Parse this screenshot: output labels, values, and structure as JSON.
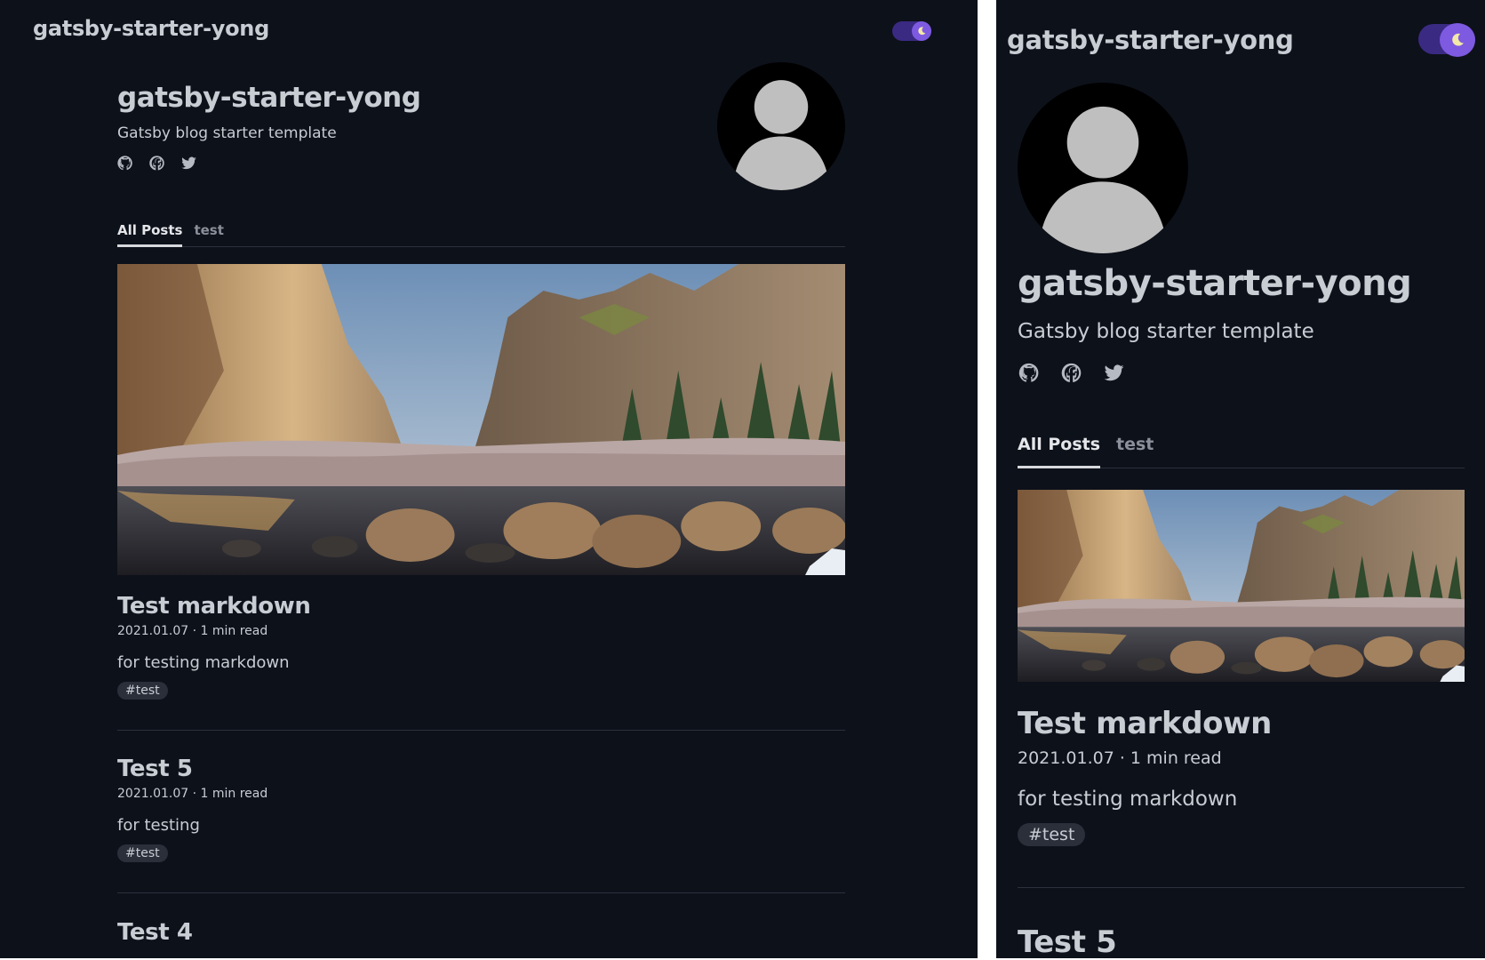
{
  "site": {
    "title": "gatsby-starter-yong",
    "theme_toggle_icon": "moon-icon"
  },
  "bio": {
    "name": "gatsby-starter-yong",
    "description": "Gatsby blog starter template",
    "socials": [
      "github-icon",
      "facebook-icon",
      "twitter-icon"
    ],
    "avatar": "avatar-placeholder-icon"
  },
  "tabs": [
    {
      "label": "All Posts",
      "active": true
    },
    {
      "label": "test",
      "active": false
    }
  ],
  "hero_image": "landscape-photo",
  "posts": [
    {
      "title": "Test markdown",
      "meta": "2021.01.07 · 1 min read",
      "description": "for testing markdown",
      "tag": "#test"
    },
    {
      "title": "Test 5",
      "meta": "2021.01.07 · 1 min read",
      "description": "for testing",
      "tag": "#test"
    },
    {
      "title": "Test 4"
    }
  ],
  "colors": {
    "background": "#0d111a",
    "text": "#c8ccd3",
    "toggle_track": "#3a2a82",
    "toggle_knob": "#7d5ae0",
    "tag_bg": "#2a2f3a",
    "divider": "#2b303b"
  }
}
